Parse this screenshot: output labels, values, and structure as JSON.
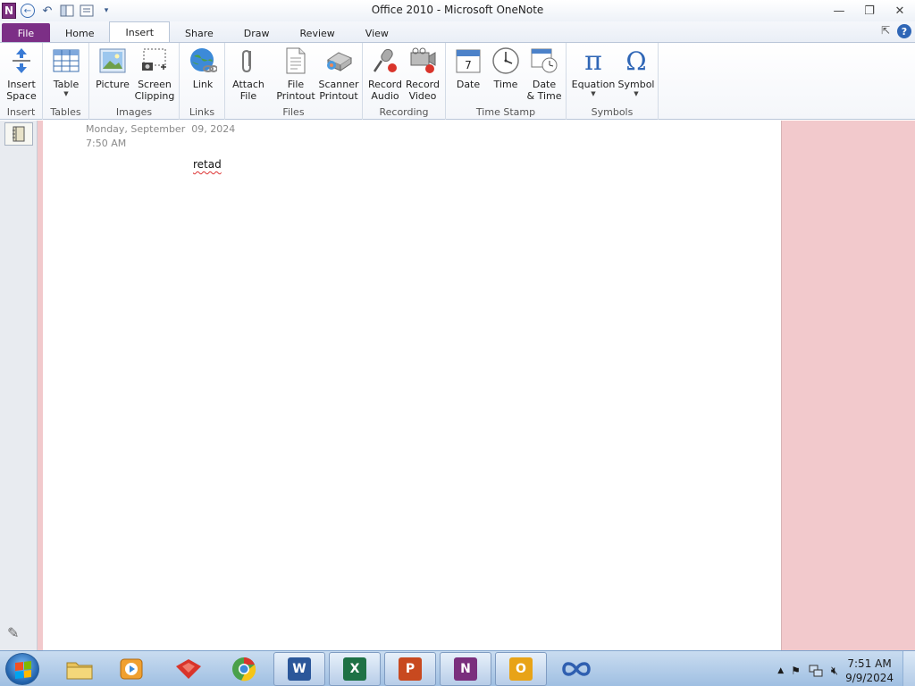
{
  "window": {
    "title": "Office 2010  -  Microsoft OneNote",
    "app_logo": "N"
  },
  "tabs": [
    {
      "label": "File"
    },
    {
      "label": "Home"
    },
    {
      "label": "Insert"
    },
    {
      "label": "Share"
    },
    {
      "label": "Draw"
    },
    {
      "label": "Review"
    },
    {
      "label": "View"
    }
  ],
  "ribbon": {
    "groups": [
      {
        "label": "Insert",
        "buttons": [
          {
            "line1": "Insert",
            "line2": "Space",
            "icon": "insert-space-icon"
          }
        ]
      },
      {
        "label": "Tables",
        "buttons": [
          {
            "line1": "Table",
            "line2": "",
            "icon": "table-icon"
          }
        ]
      },
      {
        "label": "Images",
        "buttons": [
          {
            "line1": "Picture",
            "line2": "",
            "icon": "picture-icon"
          },
          {
            "line1": "Screen",
            "line2": "Clipping",
            "icon": "screen-clipping-icon"
          }
        ]
      },
      {
        "label": "Links",
        "buttons": [
          {
            "line1": "Link",
            "line2": "",
            "icon": "link-icon"
          }
        ]
      },
      {
        "label": "Files",
        "buttons": [
          {
            "line1": "Attach",
            "line2": "File",
            "icon": "paperclip-icon"
          },
          {
            "line1": "File",
            "line2": "Printout",
            "icon": "file-printout-icon"
          },
          {
            "line1": "Scanner",
            "line2": "Printout",
            "icon": "scanner-icon"
          }
        ]
      },
      {
        "label": "Recording",
        "buttons": [
          {
            "line1": "Record",
            "line2": "Audio",
            "icon": "microphone-icon"
          },
          {
            "line1": "Record",
            "line2": "Video",
            "icon": "video-camera-icon"
          }
        ]
      },
      {
        "label": "Time Stamp",
        "buttons": [
          {
            "line1": "Date",
            "line2": "",
            "icon": "calendar-icon",
            "day": "7"
          },
          {
            "line1": "Time",
            "line2": "",
            "icon": "clock-icon"
          },
          {
            "line1": "Date",
            "line2": "& Time",
            "icon": "date-time-icon"
          }
        ]
      },
      {
        "label": "Symbols",
        "buttons": [
          {
            "line1": "Equation",
            "line2": "",
            "icon": "pi-icon",
            "glyph": "π"
          },
          {
            "line1": "Symbol",
            "line2": "",
            "icon": "omega-icon",
            "glyph": "Ω"
          }
        ]
      }
    ]
  },
  "page": {
    "date": "Monday, September  09, 2024",
    "time": "7:50 AM",
    "note_text": "retad"
  },
  "taskbar": {
    "clock_time": "7:51 AM",
    "clock_date": "9/9/2024",
    "apps": [
      {
        "name": "windows-explorer",
        "letter": ""
      },
      {
        "name": "media-player",
        "letter": ""
      },
      {
        "name": "toolbox",
        "letter": ""
      },
      {
        "name": "chrome",
        "letter": ""
      },
      {
        "name": "word",
        "letter": "W"
      },
      {
        "name": "excel",
        "letter": "X"
      },
      {
        "name": "powerpoint",
        "letter": "P"
      },
      {
        "name": "onenote",
        "letter": "N"
      },
      {
        "name": "outlook",
        "letter": "O"
      },
      {
        "name": "infinity",
        "letter": ""
      }
    ]
  },
  "colors": {
    "file_tab": "#7c2f86",
    "page_background_margin": "#f2c9cc",
    "word": "#2b579a",
    "excel": "#1e7145",
    "powerpoint": "#c8491f",
    "onenote": "#7a2f7d",
    "outlook": "#e8a317"
  }
}
